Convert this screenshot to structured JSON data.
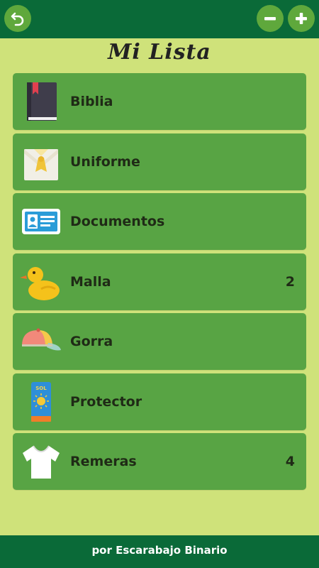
{
  "header": {
    "title": "Mi Lista",
    "back_icon": "undo-arrow-icon",
    "minus_icon": "minus-icon",
    "plus_icon": "plus-icon"
  },
  "items": [
    {
      "label": "Biblia",
      "count": "",
      "icon": "bible-icon"
    },
    {
      "label": "Uniforme",
      "count": "",
      "icon": "uniform-icon"
    },
    {
      "label": "Documentos",
      "count": "",
      "icon": "id-card-icon"
    },
    {
      "label": "Malla",
      "count": "2",
      "icon": "duck-icon"
    },
    {
      "label": "Gorra",
      "count": "",
      "icon": "cap-icon"
    },
    {
      "label": "Protector",
      "count": "",
      "icon": "sunscreen-icon"
    },
    {
      "label": "Remeras",
      "count": "4",
      "icon": "tshirt-icon"
    }
  ],
  "footer": {
    "credit": "por Escarabajo Binario"
  },
  "colors": {
    "topbar": "#0a6a38",
    "background": "#cfe27a",
    "item": "#58a444",
    "button": "#5fa83c"
  }
}
